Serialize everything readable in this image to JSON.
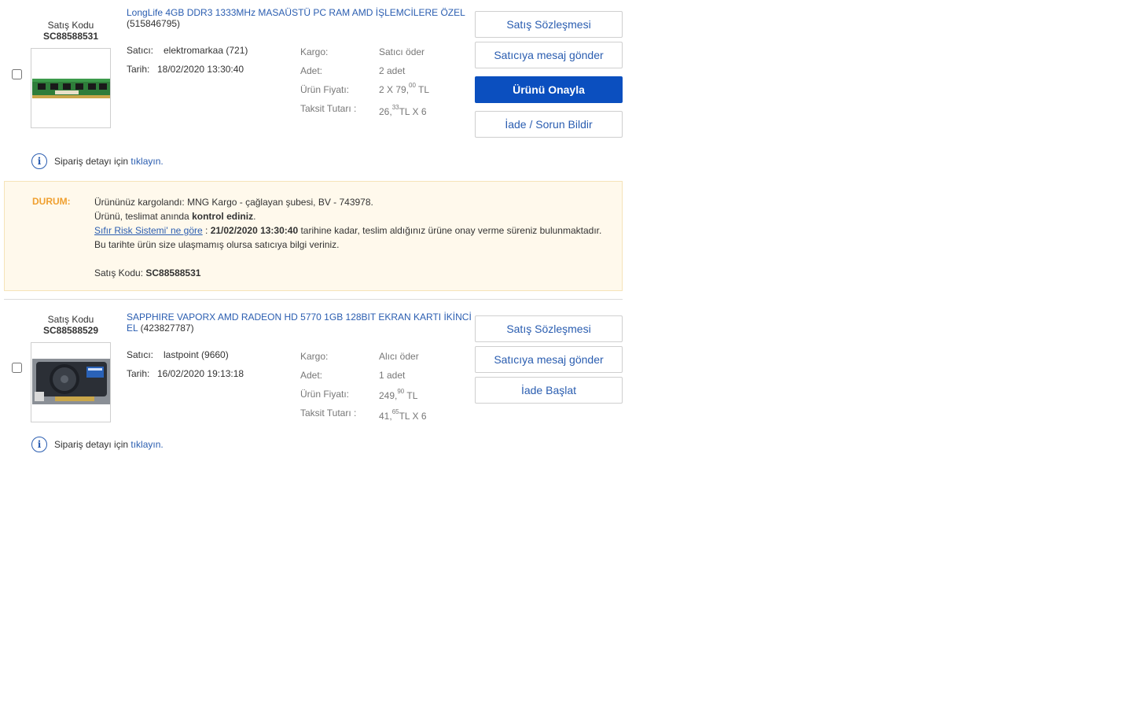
{
  "orders": [
    {
      "code_label": "Satış Kodu",
      "code": "SC88588531",
      "title": "LongLife 4GB DDR3 1333MHz MASAÜSTÜ PC RAM AMD İŞLEMCİLERE ÖZEL",
      "product_id": "(515846795)",
      "seller_label": "Satıcı:",
      "seller": "elektromarkaa (721)",
      "date_label": "Tarih:",
      "date": "18/02/2020 13:30:40",
      "cargo_label": "Kargo:",
      "cargo": "Satıcı öder",
      "qty_label": "Adet:",
      "qty": "2 adet",
      "price_label": "Ürün Fiyatı:",
      "price_main": "2 X 79,",
      "price_cents": "00",
      "price_unit": " TL",
      "installment_label": "Taksit Tutarı :",
      "installment_main": "26,",
      "installment_cents": "33",
      "installment_unit": "TL X 6",
      "buttons": {
        "contract": "Satış Sözleşmesi",
        "message": "Satıcıya mesaj gönder",
        "confirm": "Ürünü Onayla",
        "return": "İade / Sorun Bildir"
      },
      "detail_text": "Sipariş detayı için",
      "detail_link": "tıklayın."
    },
    {
      "code_label": "Satış Kodu",
      "code": "SC88588529",
      "title": "SAPPHIRE VAPORX AMD RADEON HD 5770 1GB 128BIT EKRAN KARTI İKİNCİ EL",
      "product_id": "(423827787)",
      "seller_label": "Satıcı:",
      "seller": "lastpoint (9660)",
      "date_label": "Tarih:",
      "date": "16/02/2020 19:13:18",
      "cargo_label": "Kargo:",
      "cargo": "Alıcı öder",
      "qty_label": "Adet:",
      "qty": "1 adet",
      "price_label": "Ürün Fiyatı:",
      "price_main": "249,",
      "price_cents": "90",
      "price_unit": " TL",
      "installment_label": "Taksit Tutarı :",
      "installment_main": "41,",
      "installment_cents": "65",
      "installment_unit": "TL X 6",
      "buttons": {
        "contract": "Satış Sözleşmesi",
        "message": "Satıcıya mesaj gönder",
        "return": "İade Başlat"
      },
      "detail_text": "Sipariş detayı için",
      "detail_link": "tıklayın."
    }
  ],
  "status": {
    "label": "DURUM:",
    "line1": "Ürününüz kargolandı: MNG Kargo - çağlayan şubesi, BV - 743978.",
    "line2_a": "Ürünü, teslimat anında ",
    "line2_b": "kontrol ediniz",
    "line2_c": ".",
    "line3_link": "Sıfır Risk Sistemi' ne göre",
    "line3_a": " : ",
    "line3_date": "21/02/2020 13:30:40",
    "line3_b": " tarihine kadar, teslim aldığınız ürüne onay verme süreniz bulunmaktadır.",
    "line4": "Bu tarihte ürün size ulaşmamış olursa satıcıya bilgi veriniz.",
    "code_label": "Satış Kodu: ",
    "code": "SC88588531"
  },
  "icons": {
    "info": "info-icon"
  }
}
